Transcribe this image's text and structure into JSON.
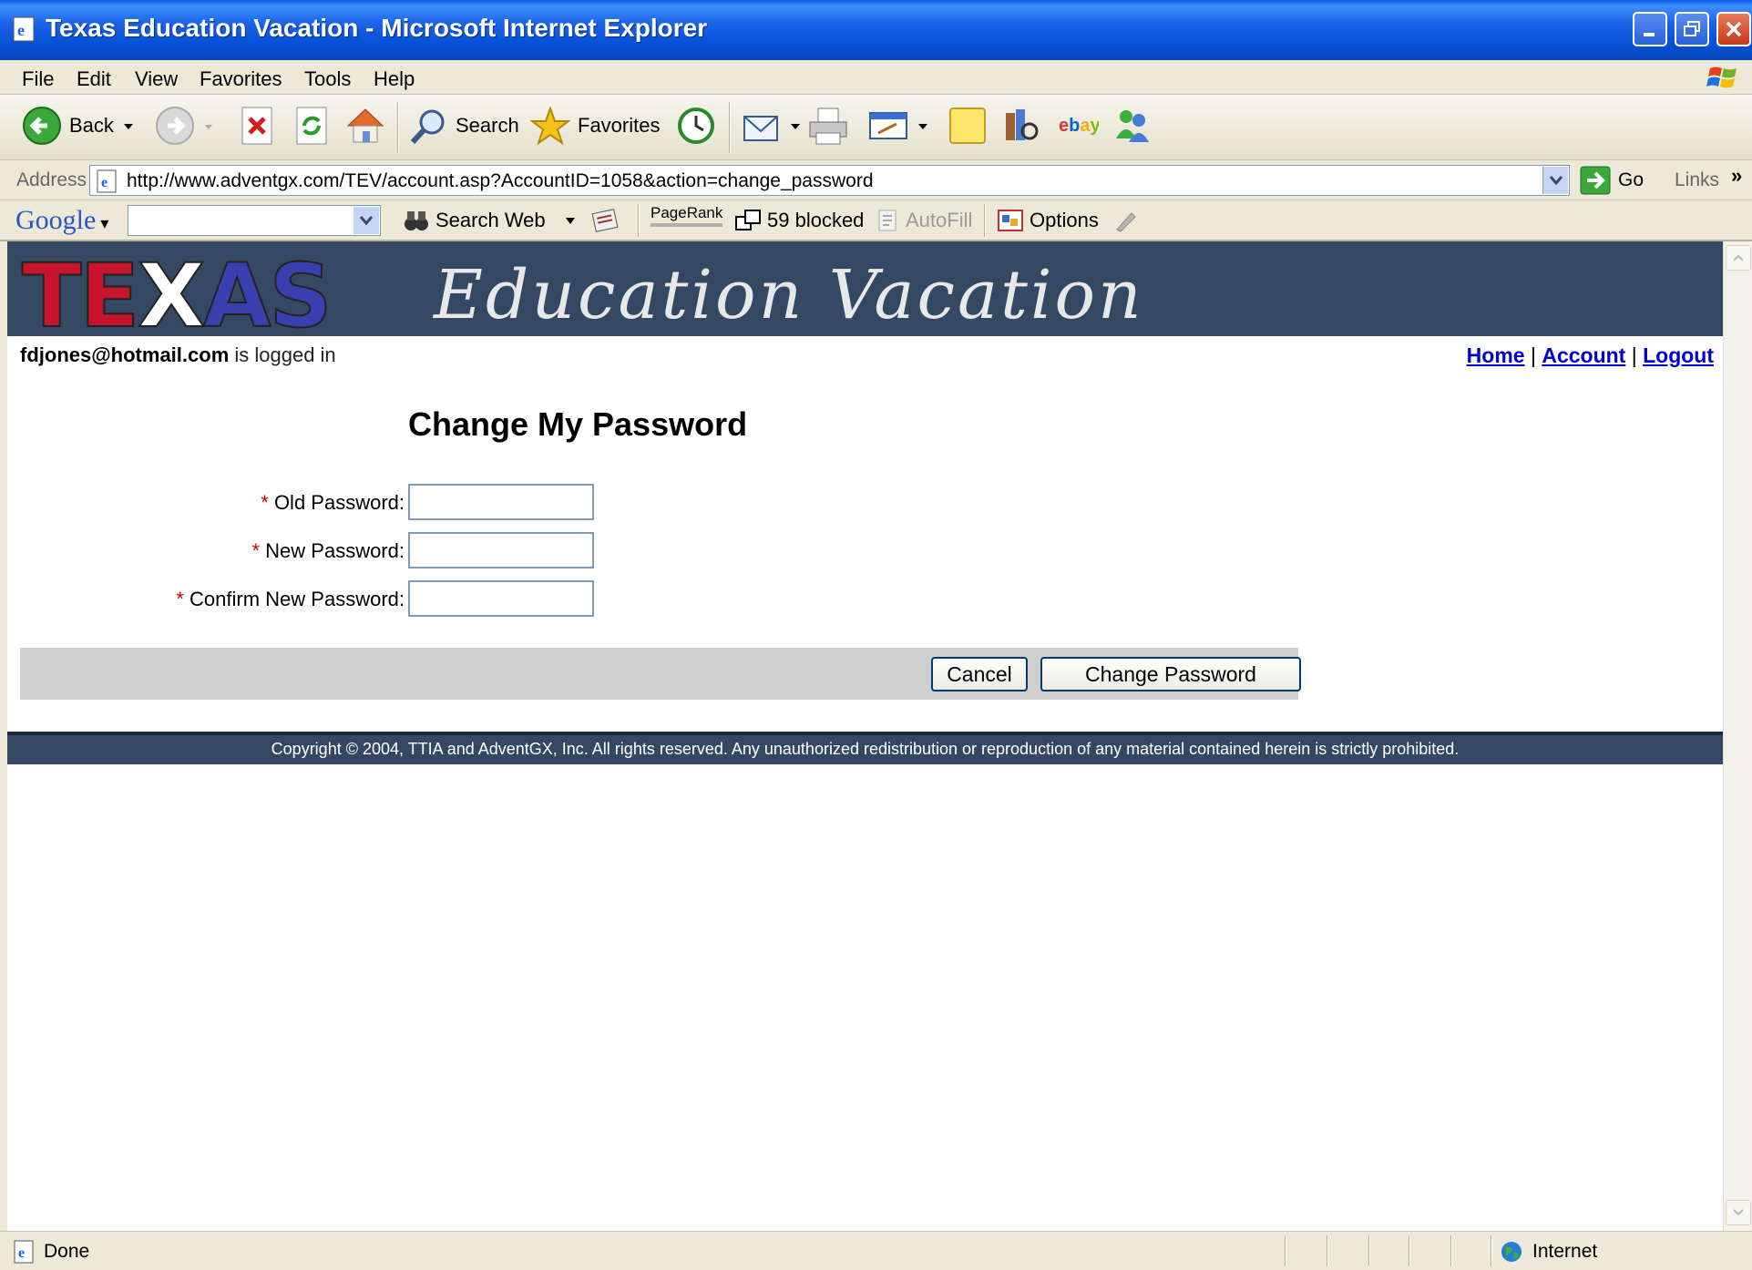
{
  "window": {
    "title": "Texas Education Vacation - Microsoft Internet Explorer"
  },
  "menu": [
    "File",
    "Edit",
    "View",
    "Favorites",
    "Tools",
    "Help"
  ],
  "toolbar": {
    "back": "Back",
    "search": "Search",
    "favorites": "Favorites"
  },
  "address": {
    "label": "Address",
    "url": "http://www.adventgx.com/TEV/account.asp?AccountID=1058&action=change_password",
    "go": "Go",
    "links": "Links",
    "chevron": "»"
  },
  "google": {
    "logo": "Google",
    "search_web": "Search Web",
    "pagerank": "PageRank",
    "blocked": "59 blocked",
    "autofill": "AutoFill",
    "options": "Options"
  },
  "site": {
    "logo_letters": [
      "T",
      "E",
      "X",
      "A",
      "S"
    ],
    "tagline": "Education Vacation",
    "user_email": "fdjones@hotmail.com",
    "user_status": " is logged in",
    "nav": [
      "Home",
      "Account",
      "Logout"
    ],
    "nav_separator": " | ",
    "heading": "Change My Password",
    "required_mark": "*",
    "fields": [
      {
        "label": "Old Password:",
        "value": ""
      },
      {
        "label": "New Password:",
        "value": ""
      },
      {
        "label": "Confirm New Password:",
        "value": ""
      }
    ],
    "cancel": "Cancel",
    "submit": "Change Password",
    "footer": "Copyright © 2004, TTIA and AdventGX, Inc. All rights reserved. Any unauthorized redistribution or reproduction of any material contained herein is strictly prohibited."
  },
  "status": {
    "text": "Done",
    "zone": "Internet"
  },
  "colors": {
    "banner": "#344864",
    "link": "#0000cc",
    "required": "#cc0000",
    "titlebar": "#0550d6"
  }
}
